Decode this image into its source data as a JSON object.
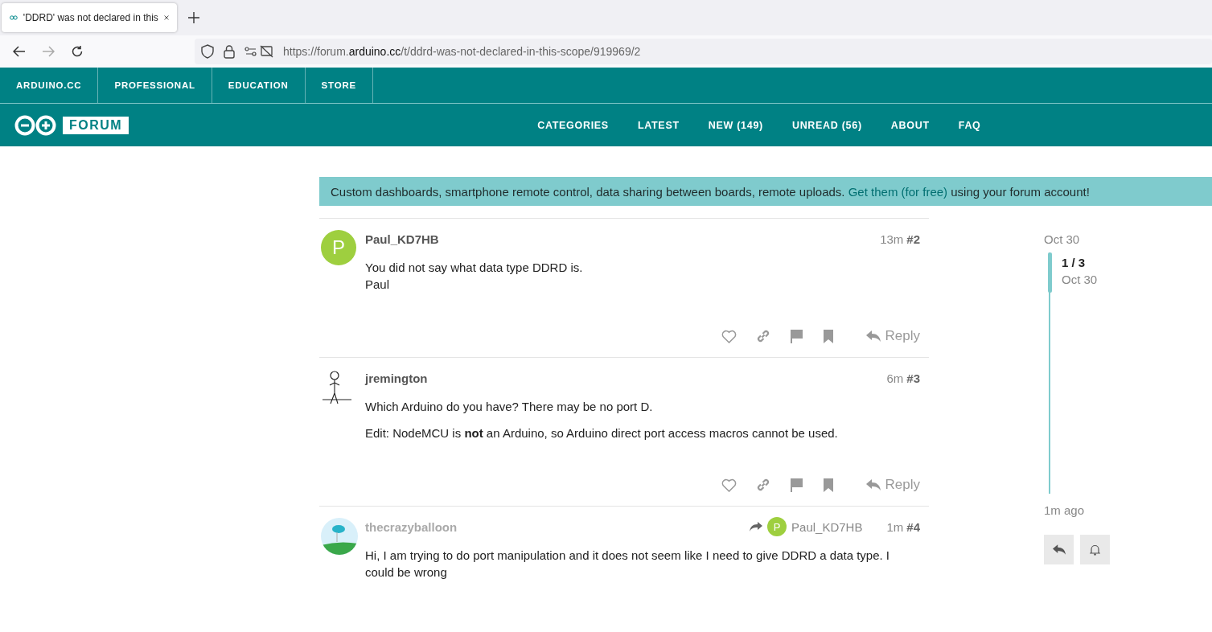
{
  "browser": {
    "tabs": [
      {
        "title": "'DDRD' was not declared in this",
        "selected": true
      }
    ],
    "url_prefix": "https://forum.",
    "url_domain": "arduino.cc",
    "url_path": "/t/ddrd-was-not-declared-in-this-scope/919969/2"
  },
  "top_nav": [
    "ARDUINO.CC",
    "PROFESSIONAL",
    "EDUCATION",
    "STORE"
  ],
  "forum_nav": {
    "logo_text": "FORUM",
    "items": [
      "CATEGORIES",
      "LATEST",
      "NEW (149)",
      "UNREAD (56)",
      "ABOUT",
      "FAQ"
    ]
  },
  "banner": {
    "text": "Custom dashboards, smartphone remote control, data sharing between boards, remote uploads.",
    "link": "Get them (for free)",
    "after": "using your forum account!"
  },
  "posts": [
    {
      "user": "Paul_KD7HB",
      "dimmed": false,
      "avatar": {
        "kind": "letter",
        "letter": "P",
        "color": "#9ecf3f"
      },
      "age": "13m",
      "number": "#2",
      "paragraphs": [
        "You did not say what data type DDRD is.\nPaul"
      ],
      "actions": "Reply"
    },
    {
      "user": "jremington",
      "dimmed": false,
      "avatar": {
        "kind": "stick"
      },
      "age": "6m",
      "number": "#3",
      "paragraphs": [
        "Which Arduino do you have? There may be no port D.",
        "Edit: NodeMCU is **not** an Arduino, so Arduino direct port access macros cannot be used."
      ],
      "actions": "Reply"
    },
    {
      "user": "thecrazyballoon",
      "dimmed": true,
      "avatar": {
        "kind": "picture"
      },
      "reply_to": {
        "user": "Paul_KD7HB",
        "letter": "P",
        "color": "#9ecf3f"
      },
      "age": "1m",
      "number": "#4",
      "paragraphs": [
        "Hi, I am trying to do port manipulation and it does not seem like I need to give DDRD a data type. I could be wrong"
      ]
    }
  ],
  "timeline": {
    "start": "Oct 30",
    "position": "1 / 3",
    "position_date": "Oct 30",
    "end": "1m ago"
  }
}
